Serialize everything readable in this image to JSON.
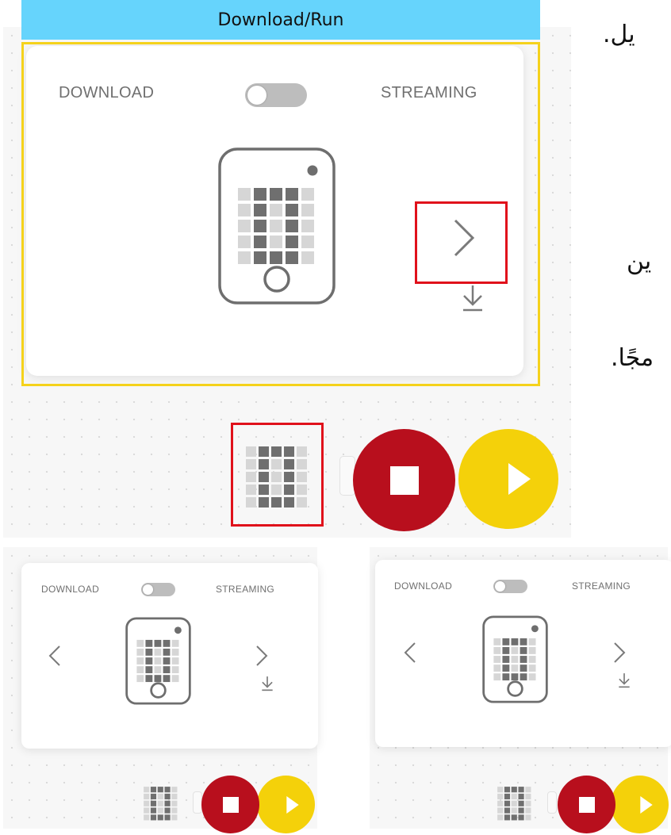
{
  "banner": {
    "title": "Download/Run"
  },
  "arabic_text": [
    "يل.",
    "ين",
    "مجًا."
  ],
  "panel": {
    "left_label": "DOWNLOAD",
    "right_label": "STREAMING",
    "toggle_on": false
  },
  "icons": {
    "device": "microbit-device-icon",
    "next": "chevron-right-icon",
    "prev": "chevron-left-icon",
    "download": "download-arrow-icon",
    "grid": "led-grid-icon",
    "stop": "stop-icon",
    "play": "play-icon"
  },
  "colors": {
    "banner": "#66d4fc",
    "highlight_frame": "#f5d21c",
    "annotation_box": "#e0111b",
    "stop_button": "#b80f1d",
    "play_button": "#f4d10a"
  },
  "small_panels": [
    {
      "left_label": "DOWNLOAD",
      "right_label": "STREAMING"
    },
    {
      "left_label": "DOWNLOAD",
      "right_label": "STREAMING"
    }
  ]
}
